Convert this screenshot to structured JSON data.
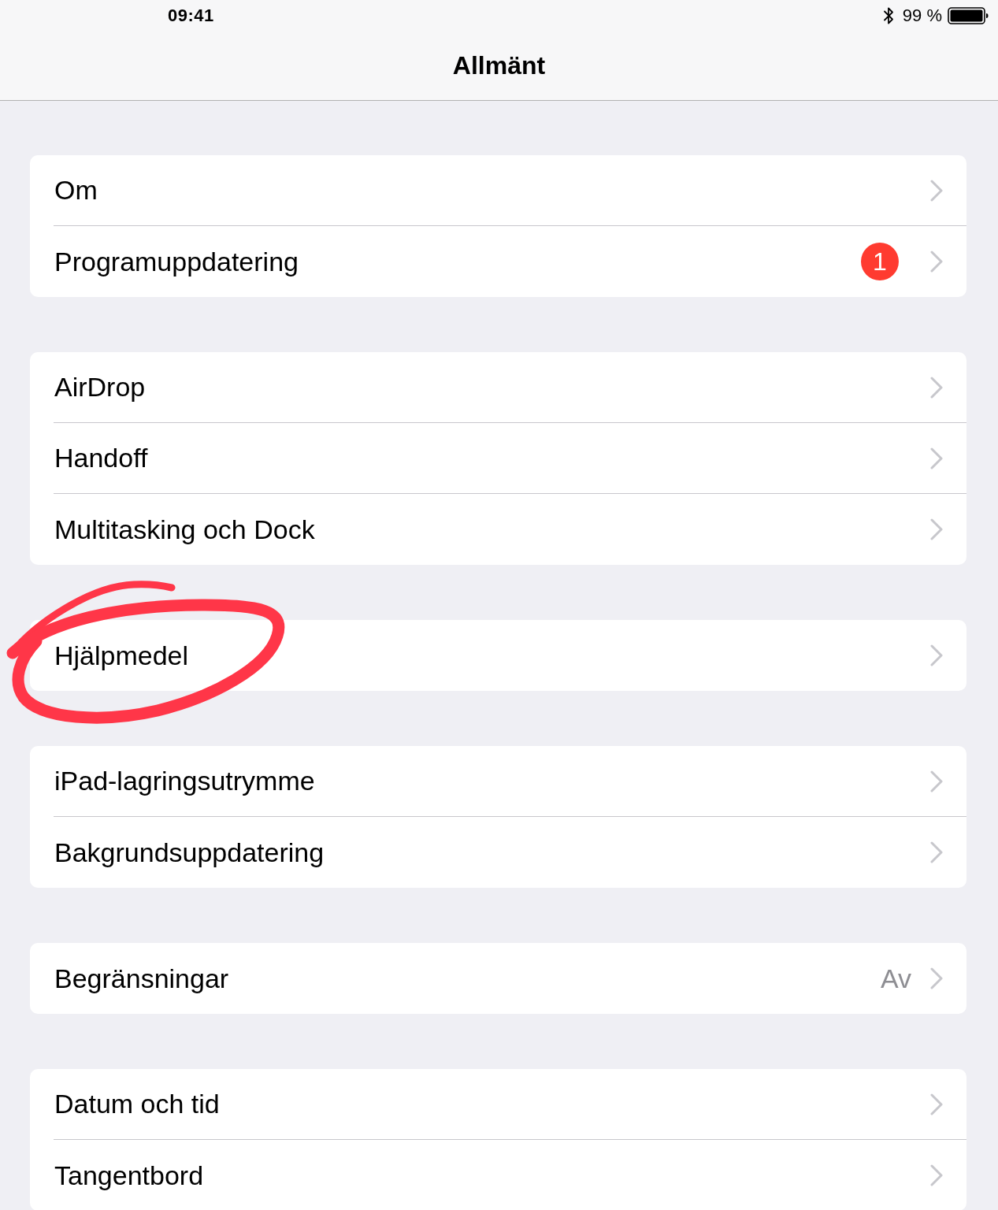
{
  "status_bar": {
    "time": "09:41",
    "battery_percent": "99 %"
  },
  "navigation_bar": {
    "title": "Allmänt"
  },
  "sections": [
    {
      "rows": [
        {
          "label": "Om",
          "circled": false
        },
        {
          "label": "Programuppdatering",
          "badge": "1",
          "circled": false
        }
      ]
    },
    {
      "rows": [
        {
          "label": "AirDrop",
          "circled": false
        },
        {
          "label": "Handoff",
          "circled": false
        },
        {
          "label": "Multitasking och Dock",
          "circled": false
        }
      ]
    },
    {
      "rows": [
        {
          "label": "Hjälpmedel",
          "circled": true
        }
      ]
    },
    {
      "rows": [
        {
          "label": "iPad-lagringsutrymme",
          "circled": false
        },
        {
          "label": "Bakgrundsuppdatering",
          "circled": false
        }
      ]
    },
    {
      "rows": [
        {
          "label": "Begränsningar",
          "value": "Av",
          "circled": false
        }
      ]
    },
    {
      "rows": [
        {
          "label": "Datum och tid",
          "circled": false
        },
        {
          "label": "Tangentbord",
          "circled": false
        }
      ]
    }
  ]
}
